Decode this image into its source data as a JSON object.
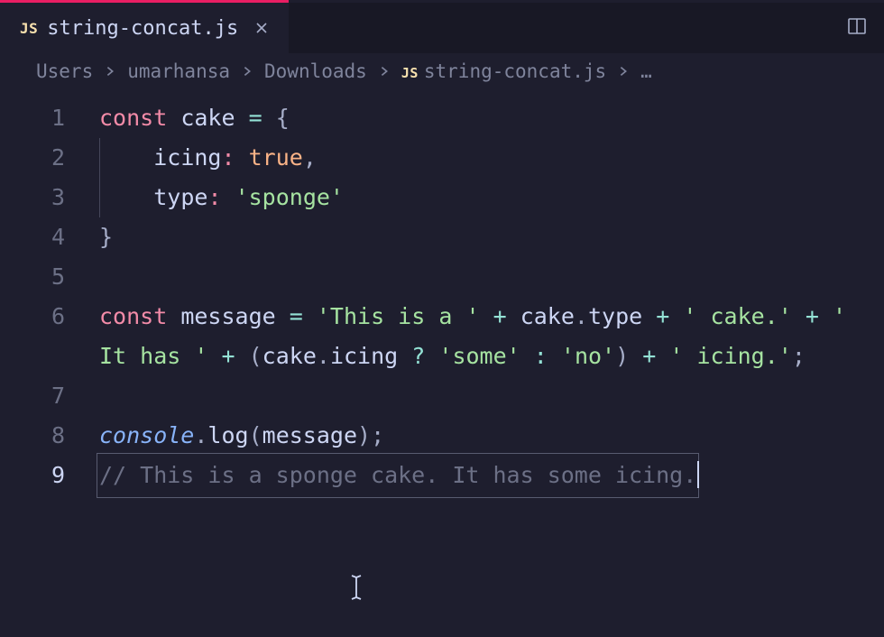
{
  "tab": {
    "filetype_badge": "JS",
    "filename": "string-concat.js"
  },
  "breadcrumbs": {
    "items": [
      "Users",
      "umarhansa",
      "Downloads"
    ],
    "file_badge": "JS",
    "file": "string-concat.js",
    "trail": "…"
  },
  "editor": {
    "lines": {
      "l1": {
        "num": "1",
        "kw": "const",
        "id": "cake",
        "brace": "{"
      },
      "l2": {
        "num": "2",
        "prop": "icing",
        "val": "true"
      },
      "l3": {
        "num": "3",
        "prop": "type",
        "val": "'sponge'"
      },
      "l4": {
        "num": "4",
        "brace": "}"
      },
      "l5": {
        "num": "5"
      },
      "l6": {
        "num": "6",
        "kw": "const",
        "id": "message",
        "s1": "'This is a '",
        "obj1a": "cake",
        "obj1b": "type",
        "s2": "' cake.'",
        "s3": "' It has '",
        "obj2a": "cake",
        "obj2b": "icing",
        "tern1": "'some'",
        "tern2": "'no'",
        "s4": "' icing.'"
      },
      "l7": {
        "num": "7"
      },
      "l8": {
        "num": "8",
        "obj": "console",
        "fn": "log",
        "arg": "message"
      },
      "l9": {
        "num": "9",
        "comment": "// This is a sponge cake. It has some icing."
      }
    }
  }
}
